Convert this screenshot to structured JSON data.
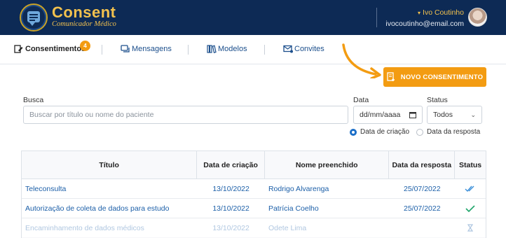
{
  "header": {
    "brand_title": "Consent",
    "brand_subtitle": "Comunicador Médico",
    "user_name": "Ivo Coutinho",
    "user_email": "ivocoutinho@email.com"
  },
  "nav": {
    "items": [
      {
        "label": "Consentimentos",
        "icon": "consent-icon",
        "active": true,
        "badge": "4"
      },
      {
        "label": "Mensagens",
        "icon": "messages-icon"
      },
      {
        "label": "Modelos",
        "icon": "books-icon"
      },
      {
        "label": "Convites",
        "icon": "mail-icon"
      }
    ]
  },
  "new_consent_button": "NOVO CONSENTIMENTO",
  "filters": {
    "search_label": "Busca",
    "search_placeholder": "Buscar por título ou nome do paciente",
    "date_label": "Data",
    "date_placeholder": "dd/mm/aaaa",
    "status_label": "Status",
    "status_value": "Todos",
    "radio_creation": "Data de criação",
    "radio_response": "Data da resposta"
  },
  "table": {
    "headers": [
      "Título",
      "Data de criação",
      "Nome preenchido",
      "Data da resposta",
      "Status"
    ],
    "rows": [
      [
        "Teleconsulta",
        "13/10/2022",
        "Rodrigo Alvarenga",
        "25/07/2022",
        "double-check-icon"
      ],
      [
        "Autorização de coleta de dados para estudo",
        "13/10/2022",
        "Patrícia Coelho",
        "25/07/2022",
        "check-icon"
      ],
      [
        "Encaminhamento de dados médicos",
        "13/10/2022",
        "Odete Lima",
        "",
        "hourglass-icon"
      ]
    ]
  },
  "colors": {
    "header_bg": "#0d2a55",
    "brand_gold": "#f2c14e",
    "accent_orange": "#f39c12",
    "link_blue": "#1c5fa8",
    "status_green": "#1fa56b"
  }
}
